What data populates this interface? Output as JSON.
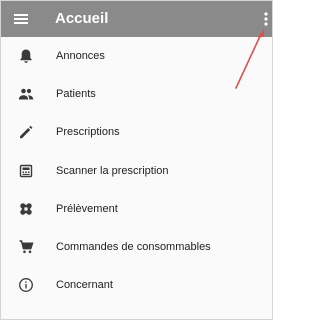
{
  "app_bar": {
    "title": "Accueil",
    "menu_icon": "hamburger-menu-icon",
    "overflow_icon": "more-vertical-icon",
    "background_color": "#8a8a8a"
  },
  "menu": {
    "items": [
      {
        "label": "Annonces",
        "icon": "bell-icon"
      },
      {
        "label": "Patients",
        "icon": "people-icon"
      },
      {
        "label": "Prescriptions",
        "icon": "pencil-icon"
      },
      {
        "label": "Scanner la prescription",
        "icon": "scanner-icon"
      },
      {
        "label": "Prélèvement",
        "icon": "bandage-icon"
      },
      {
        "label": "Commandes de consommables",
        "icon": "cart-icon"
      },
      {
        "label": "Concernant",
        "icon": "info-icon"
      }
    ]
  },
  "annotation": {
    "arrow_color": "#e05050"
  }
}
